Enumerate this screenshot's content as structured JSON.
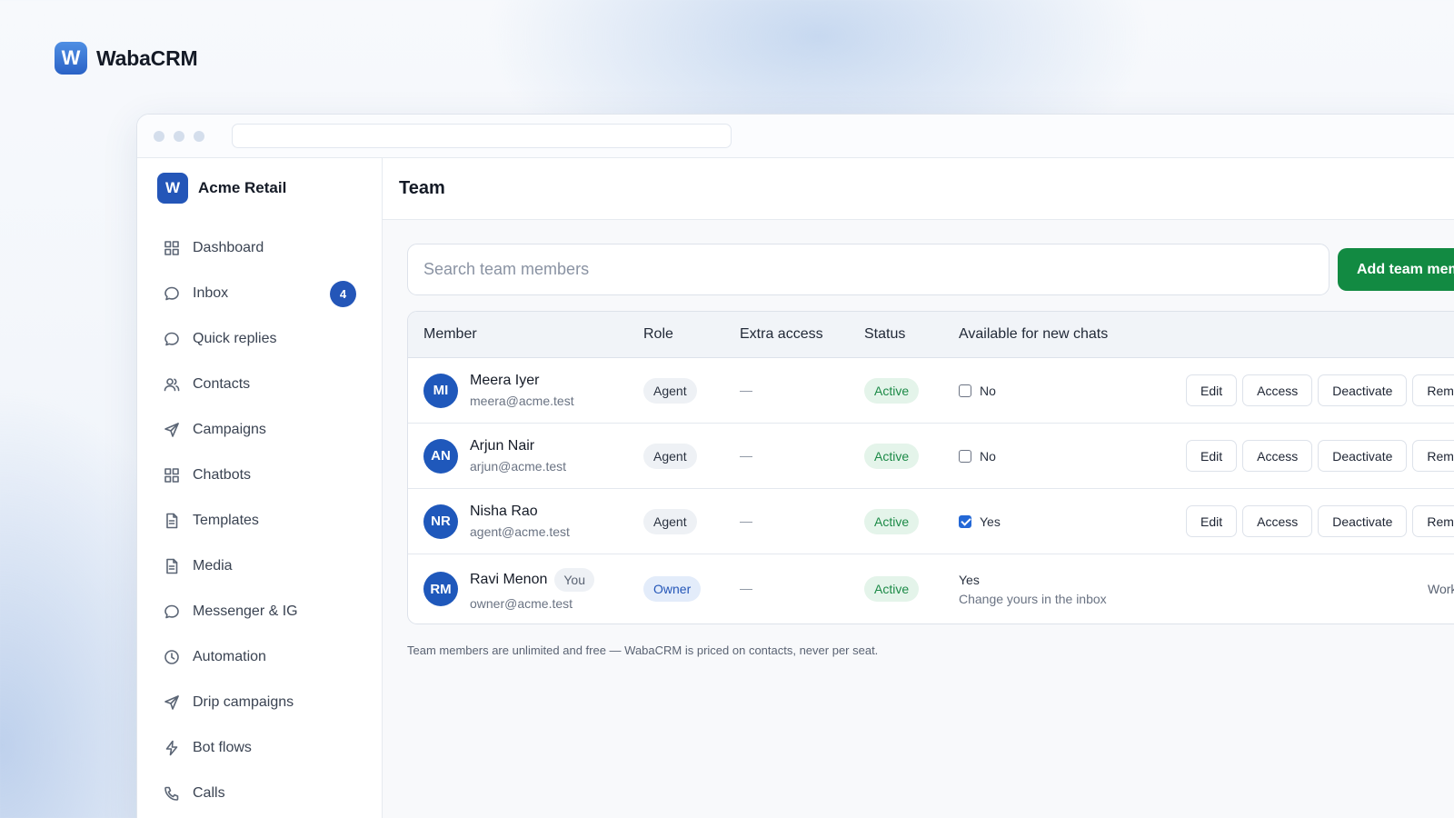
{
  "brand": {
    "logo_letter": "W",
    "name": "WabaCRM"
  },
  "workspace": {
    "logo_letter": "W",
    "name": "Acme Retail"
  },
  "sidebar": {
    "items": [
      {
        "label": "Dashboard",
        "icon": "grid-icon"
      },
      {
        "label": "Inbox",
        "icon": "chat-icon",
        "badge": "4"
      },
      {
        "label": "Quick replies",
        "icon": "chat-icon"
      },
      {
        "label": "Contacts",
        "icon": "users-icon"
      },
      {
        "label": "Campaigns",
        "icon": "send-icon"
      },
      {
        "label": "Chatbots",
        "icon": "grid-icon"
      },
      {
        "label": "Templates",
        "icon": "document-icon"
      },
      {
        "label": "Media",
        "icon": "document-icon"
      },
      {
        "label": "Messenger & IG",
        "icon": "chat-icon"
      },
      {
        "label": "Automation",
        "icon": "clock-icon"
      },
      {
        "label": "Drip campaigns",
        "icon": "send-icon"
      },
      {
        "label": "Bot flows",
        "icon": "bolt-icon"
      },
      {
        "label": "Calls",
        "icon": "phone-icon"
      }
    ]
  },
  "page": {
    "title": "Team"
  },
  "search": {
    "placeholder": "Search team members"
  },
  "toolbar": {
    "add_label": "Add team member"
  },
  "table": {
    "headers": {
      "member": "Member",
      "role": "Role",
      "extra": "Extra access",
      "status": "Status",
      "available": "Available for new chats"
    },
    "rows": [
      {
        "initials": "MI",
        "name": "Meera Iyer",
        "email": "meera@acme.test",
        "role": "Agent",
        "extra": "—",
        "status": "Active",
        "available": "No",
        "available_checked": false
      },
      {
        "initials": "AN",
        "name": "Arjun Nair",
        "email": "arjun@acme.test",
        "role": "Agent",
        "extra": "—",
        "status": "Active",
        "available": "No",
        "available_checked": false
      },
      {
        "initials": "NR",
        "name": "Nisha Rao",
        "email": "agent@acme.test",
        "role": "Agent",
        "extra": "—",
        "status": "Active",
        "available": "Yes",
        "available_checked": true
      }
    ],
    "owner_row": {
      "initials": "RM",
      "name": "Ravi Menon",
      "you": "You",
      "email": "owner@acme.test",
      "role": "Owner",
      "extra": "—",
      "status": "Active",
      "available": "Yes",
      "available_sub": "Change yours in the inbox",
      "note": "Workspace owner"
    },
    "actions": {
      "edit": "Edit",
      "access": "Access",
      "deactivate": "Deactivate",
      "remove": "Remove"
    }
  },
  "footnote": "Team members are unlimited and free — WabaCRM is priced on contacts, never per seat.",
  "colors": {
    "brand_blue": "#2456b8",
    "primary_green": "#128a42",
    "status_green": "#1c8a47"
  }
}
